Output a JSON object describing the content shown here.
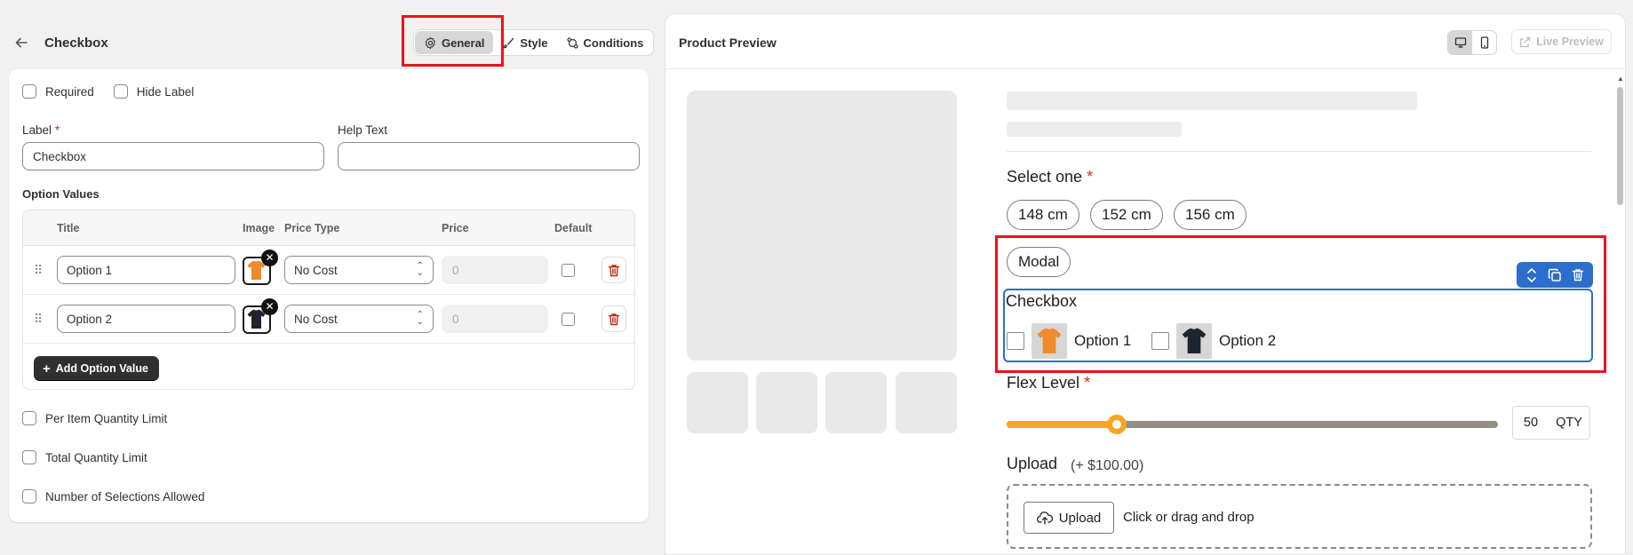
{
  "editor": {
    "title": "Checkbox",
    "tabs": [
      {
        "label": "General",
        "icon": "gear-icon",
        "active": true
      },
      {
        "label": "Style",
        "icon": "brush-icon",
        "active": false
      },
      {
        "label": "Conditions",
        "icon": "conditions-icon",
        "active": false
      }
    ],
    "checks": {
      "required": "Required",
      "hide_label": "Hide Label"
    },
    "label_field": {
      "label": "Label",
      "required_mark": "*",
      "value": "Checkbox"
    },
    "help_field": {
      "label": "Help Text",
      "value": ""
    },
    "option_values_title": "Option Values",
    "table": {
      "headers": {
        "title": "Title",
        "image": "Image",
        "price_type": "Price Type",
        "price": "Price",
        "default": "Default"
      },
      "rows": [
        {
          "title": "Option 1",
          "image_color": "#f08a2a",
          "price_type": "No Cost",
          "price_placeholder": "0"
        },
        {
          "title": "Option 2",
          "image_color": "#1f2530",
          "price_type": "No Cost",
          "price_placeholder": "0"
        }
      ],
      "add_button": "Add Option Value"
    },
    "limits": {
      "per_item": "Per Item Quantity Limit",
      "total": "Total Quantity Limit",
      "selections": "Number of Selections Allowed"
    }
  },
  "preview": {
    "title": "Product Preview",
    "live_preview": "Live Preview",
    "select_one": {
      "label": "Select one",
      "required_mark": "*",
      "options": [
        "148 cm",
        "152 cm",
        "156 cm",
        "Modal"
      ]
    },
    "checkbox": {
      "label": "Checkbox",
      "options": [
        "Option 1",
        "Option 2"
      ]
    },
    "flex": {
      "label": "Flex Level",
      "required_mark": "*",
      "value_fraction": 0.225,
      "qty": "50",
      "qty_unit": "QTY"
    },
    "upload": {
      "label": "Upload",
      "price": "(+ $100.00)",
      "button": "Upload",
      "hint": "Click or drag and drop"
    }
  },
  "colors": {
    "accent_blue": "#2c6ecb",
    "highlight_red": "#e8141f",
    "slider_orange": "#f5a623",
    "required_red": "#d72c0d"
  }
}
